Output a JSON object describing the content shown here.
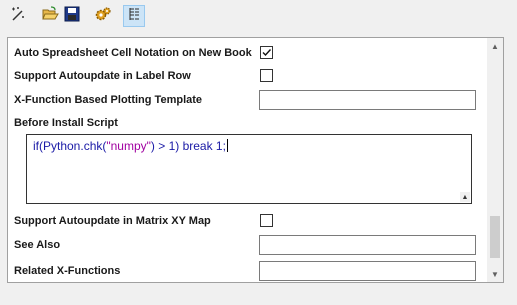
{
  "toolbar": {
    "buttons": [
      {
        "icon": "magic-wand-icon"
      },
      {
        "icon": "open-folder-icon"
      },
      {
        "icon": "save-disk-icon"
      },
      {
        "icon": "settings-gears-icon"
      },
      {
        "icon": "tree-view-icon",
        "active": true
      }
    ]
  },
  "settings": {
    "auto_spreadsheet": {
      "label": "Auto Spreadsheet Cell Notation on New Book",
      "checked": true
    },
    "support_autoupdate_label_row": {
      "label": "Support Autoupdate in Label Row",
      "checked": false
    },
    "xfunction_plotting_template": {
      "label": "X-Function Based Plotting Template",
      "value": ""
    },
    "before_install_script": {
      "label": "Before Install Script",
      "code_prefix": "if(Python.chk(",
      "code_string": "\"numpy\"",
      "code_suffix": ") > 1) break 1;"
    },
    "support_autoupdate_matrix": {
      "label": "Support Autoupdate in Matrix XY Map",
      "checked": false
    },
    "see_also": {
      "label": "See Also",
      "value": ""
    },
    "related_xfunctions": {
      "label": "Related X-Functions",
      "value": ""
    }
  },
  "colors": {
    "code_keyword": "#1a1aa6",
    "code_string": "#a000a0",
    "active_button": "#cce4f7"
  }
}
